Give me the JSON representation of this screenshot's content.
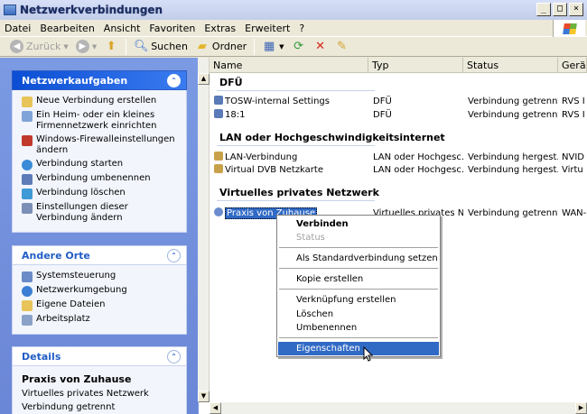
{
  "window": {
    "title": "Netzwerkverbindungen"
  },
  "menu": [
    "Datei",
    "Bearbeiten",
    "Ansicht",
    "Favoriten",
    "Extras",
    "Erweitert",
    "?"
  ],
  "toolbar": {
    "back": "Zurück",
    "search": "Suchen",
    "folders": "Ordner"
  },
  "tasks": {
    "network_tasks": {
      "header": "Netzwerkaufgaben",
      "items": [
        "Neue Verbindung erstellen",
        "Ein Heim- oder ein kleines Firmennetzwerk einrichten",
        "Windows-Firewalleinstellungen ändern",
        "Verbindung starten",
        "Verbindung umbenennen",
        "Verbindung löschen",
        "Einstellungen dieser Verbindung ändern"
      ]
    },
    "other_places": {
      "header": "Andere Orte",
      "items": [
        "Systemsteuerung",
        "Netzwerkumgebung",
        "Eigene Dateien",
        "Arbeitsplatz"
      ]
    },
    "details": {
      "header": "Details",
      "name": "Praxis von Zuhause",
      "type": "Virtuelles privates Netzwerk",
      "status": "Verbindung getrennt"
    }
  },
  "columns": [
    "Name",
    "Typ",
    "Status",
    "Gerä"
  ],
  "groups": [
    {
      "title": "DFÜ",
      "rows": [
        {
          "name": "TOSW-internal Settings",
          "type": "DFÜ",
          "status": "Verbindung getrennt",
          "device": "RVS I"
        },
        {
          "name": "18:1",
          "type": "DFÜ",
          "status": "Verbindung getrennt",
          "device": "RVS I"
        }
      ]
    },
    {
      "title": "LAN oder Hochgeschwindigkeitsinternet",
      "rows": [
        {
          "name": "LAN-Verbindung",
          "type": "LAN oder Hochgesc...",
          "status": "Verbindung hergest...",
          "device": "NVID"
        },
        {
          "name": "Virtual DVB Netzkarte",
          "type": "LAN oder Hochgesc...",
          "status": "Verbindung hergest...",
          "device": "Virtu"
        }
      ]
    },
    {
      "title": "Virtuelles privates Netzwerk",
      "rows": [
        {
          "name": "Praxis von Zuhause",
          "type": "Virtuelles privates N...",
          "status": "Verbindung getrennt",
          "device": "WAN-"
        }
      ]
    }
  ],
  "context_menu": {
    "items": [
      "Verbinden",
      "Status",
      "Als Standardverbindung setzen",
      "Kopie erstellen",
      "Verknüpfung erstellen",
      "Löschen",
      "Umbenennen",
      "Eigenschaften"
    ]
  }
}
